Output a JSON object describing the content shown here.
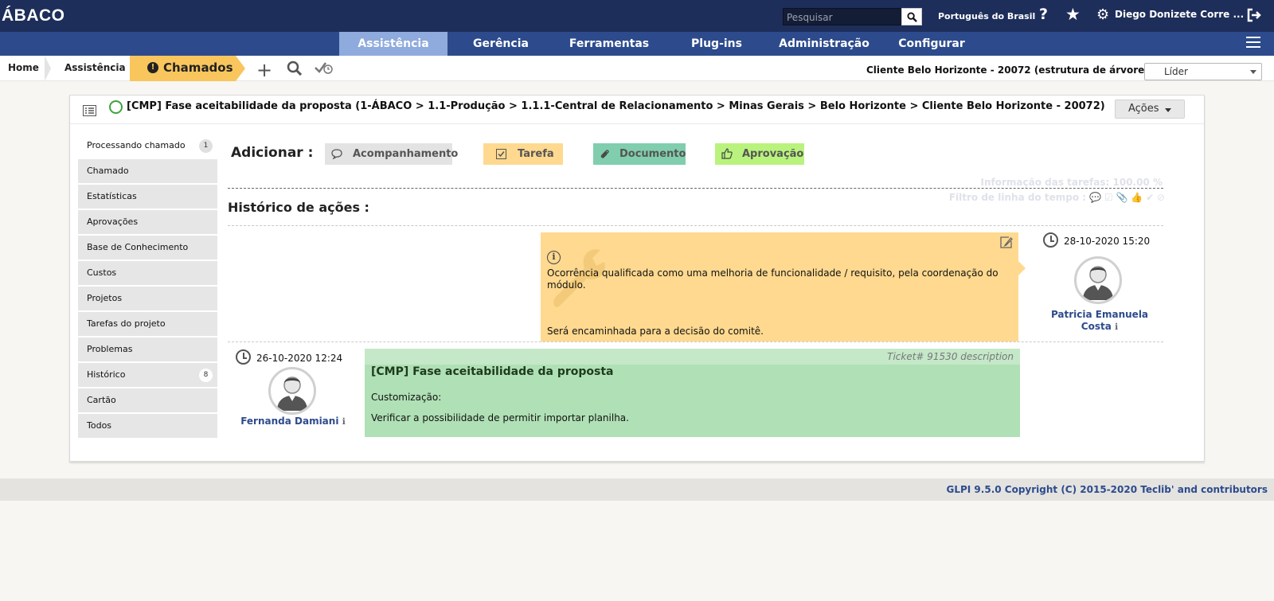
{
  "app": {
    "logo": "ÁBACO",
    "search_placeholder": "Pesquisar",
    "language": "Português do Brasil",
    "user": "Diego Donizete Corre ...",
    "colors": {
      "topbar": "#1e2e5a",
      "menubar": "#2d4b8c",
      "active_menu": "#8faadc"
    }
  },
  "menu": {
    "items": [
      {
        "label": "Assistência",
        "active": true
      },
      {
        "label": "Gerência",
        "active": false
      },
      {
        "label": "Ferramentas",
        "active": false
      },
      {
        "label": "Plug-ins",
        "active": false
      },
      {
        "label": "Administração",
        "active": false
      },
      {
        "label": "Configurar",
        "active": false
      }
    ]
  },
  "breadcrumb": {
    "items": [
      "Home",
      "Assistência",
      "Chamados"
    ],
    "entity": "Cliente Belo Horizonte - 20072 (estrutura de árvore)",
    "profile": "Líder"
  },
  "ticket": {
    "title": "[CMP] Fase aceitabilidade da proposta (1-ÁBACO > 1.1-Produção > 1.1.1-Central de Relacionamento > Minas Gerais > Belo Horizonte > Cliente Belo Horizonte - 20072)",
    "actions_label": "Ações"
  },
  "tabs": [
    {
      "label": "Processando chamado",
      "badge": "1",
      "active": true
    },
    {
      "label": "Chamado"
    },
    {
      "label": "Estatísticas"
    },
    {
      "label": "Aprovações"
    },
    {
      "label": "Base de Conhecimento"
    },
    {
      "label": "Custos"
    },
    {
      "label": "Projetos"
    },
    {
      "label": "Tarefas do projeto"
    },
    {
      "label": "Problemas"
    },
    {
      "label": "Histórico",
      "badge": "8"
    },
    {
      "label": "Cartão"
    },
    {
      "label": "Todos"
    }
  ],
  "add": {
    "label": "Adicionar :",
    "buttons": [
      {
        "label": "Acompanhamento",
        "icon": "speech-bubble-icon",
        "color": "#e3e3e3"
      },
      {
        "label": "Tarefa",
        "icon": "checkbox-icon",
        "color": "#fed98f"
      },
      {
        "label": "Documento",
        "icon": "paperclip-icon",
        "color": "#80cead"
      },
      {
        "label": "Aprovação",
        "icon": "thumbs-up-icon",
        "color": "#b9f37d"
      }
    ]
  },
  "timeline": {
    "task_info": "Informação das tarefas: 100.00 %",
    "filter_label": "Filtro de linha do tempo :",
    "filter_icons": "💬 ☑ 📎 👍 ✔ ⊘",
    "history_title": "Histórico de ações :",
    "task": {
      "date": "28-10-2020 15:20",
      "author_line1": "Patricia Emanuela",
      "author_line2": "Costa",
      "text1": "Ocorrência qualificada como uma melhoria de funcionalidade / requisito, pela coordenação do",
      "text2": "módulo.",
      "text3": "Será encaminhada para a decisão do comitê."
    },
    "description": {
      "date": "26-10-2020 12:24",
      "author": "Fernanda Damiani",
      "label": "Ticket# 91530 description",
      "title": "[CMP] Fase aceitabilidade da proposta",
      "line1": "Customização:",
      "line2": "Verificar a possibilidade de permitir importar planilha."
    }
  },
  "footer": {
    "text": "GLPI 9.5.0 Copyright (C) 2015-2020 Teclib' and contributors"
  }
}
